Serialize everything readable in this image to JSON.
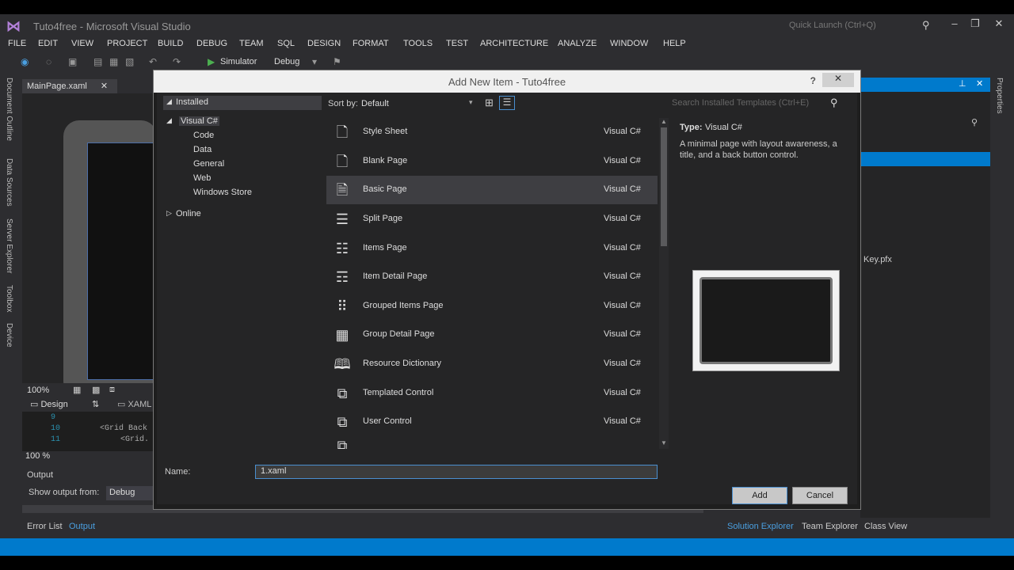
{
  "window": {
    "title": "Tuto4free - Microsoft Visual Studio",
    "quick_launch": "Quick Launch (Ctrl+Q)"
  },
  "menu": [
    "FILE",
    "EDIT",
    "VIEW",
    "PROJECT",
    "BUILD",
    "DEBUG",
    "TEAM",
    "SQL",
    "DESIGN",
    "FORMAT",
    "TOOLS",
    "TEST",
    "ARCHITECTURE",
    "ANALYZE",
    "WINDOW",
    "HELP"
  ],
  "toolbar": {
    "run_target": "Simulator",
    "config": "Debug"
  },
  "left_tabs": [
    "Document Outline",
    "Data Sources",
    "Server Explorer",
    "Toolbox",
    "Device"
  ],
  "doc_tab": "MainPage.xaml",
  "designer": {
    "zoom": "100%",
    "design_tab": "Design",
    "xaml_tab": "XAML",
    "code_zoom": "100 %"
  },
  "code": {
    "lines": [
      {
        "num": "9",
        "text": ""
      },
      {
        "num": "10",
        "text": "<Grid Back"
      },
      {
        "num": "11",
        "text": "<Grid."
      }
    ]
  },
  "output": {
    "title": "Output",
    "show_from_label": "Show output from:",
    "show_from_value": "Debug"
  },
  "bottom_tabs": {
    "left": [
      "Error List",
      "Output"
    ],
    "right": [
      "Solution Explorer",
      "Team Explorer",
      "Class View"
    ]
  },
  "solution": {
    "file": "Key.pfx"
  },
  "right_strip": "Properties",
  "dialog": {
    "title": "Add New Item - Tuto4free",
    "tree": {
      "installed": "Installed",
      "visual_csharp": "Visual C#",
      "children": [
        "Code",
        "Data",
        "General",
        "Web",
        "Windows Store"
      ],
      "online": "Online"
    },
    "sort_label": "Sort by:",
    "sort_value": "Default",
    "search_placeholder": "Search Installed Templates (Ctrl+E)",
    "items": [
      {
        "name": "Style Sheet",
        "type": "Visual C#",
        "icon": "style-sheet-icon"
      },
      {
        "name": "Blank Page",
        "type": "Visual C#",
        "icon": "blank-page-icon"
      },
      {
        "name": "Basic Page",
        "type": "Visual C#",
        "icon": "basic-page-icon"
      },
      {
        "name": "Split Page",
        "type": "Visual C#",
        "icon": "split-page-icon"
      },
      {
        "name": "Items Page",
        "type": "Visual C#",
        "icon": "items-page-icon"
      },
      {
        "name": "Item Detail Page",
        "type": "Visual C#",
        "icon": "item-detail-page-icon"
      },
      {
        "name": "Grouped Items Page",
        "type": "Visual C#",
        "icon": "grouped-items-page-icon"
      },
      {
        "name": "Group Detail Page",
        "type": "Visual C#",
        "icon": "group-detail-page-icon"
      },
      {
        "name": "Resource Dictionary",
        "type": "Visual C#",
        "icon": "resource-dictionary-icon"
      },
      {
        "name": "Templated Control",
        "type": "Visual C#",
        "icon": "templated-control-icon"
      },
      {
        "name": "User Control",
        "type": "Visual C#",
        "icon": "user-control-icon"
      }
    ],
    "info": {
      "type_label": "Type:",
      "type_value": "Visual C#",
      "description": "A minimal page with layout awareness, a title, and a back button control."
    },
    "name_label": "Name:",
    "name_value": "1.xaml",
    "add_label": "Add",
    "cancel_label": "Cancel"
  }
}
